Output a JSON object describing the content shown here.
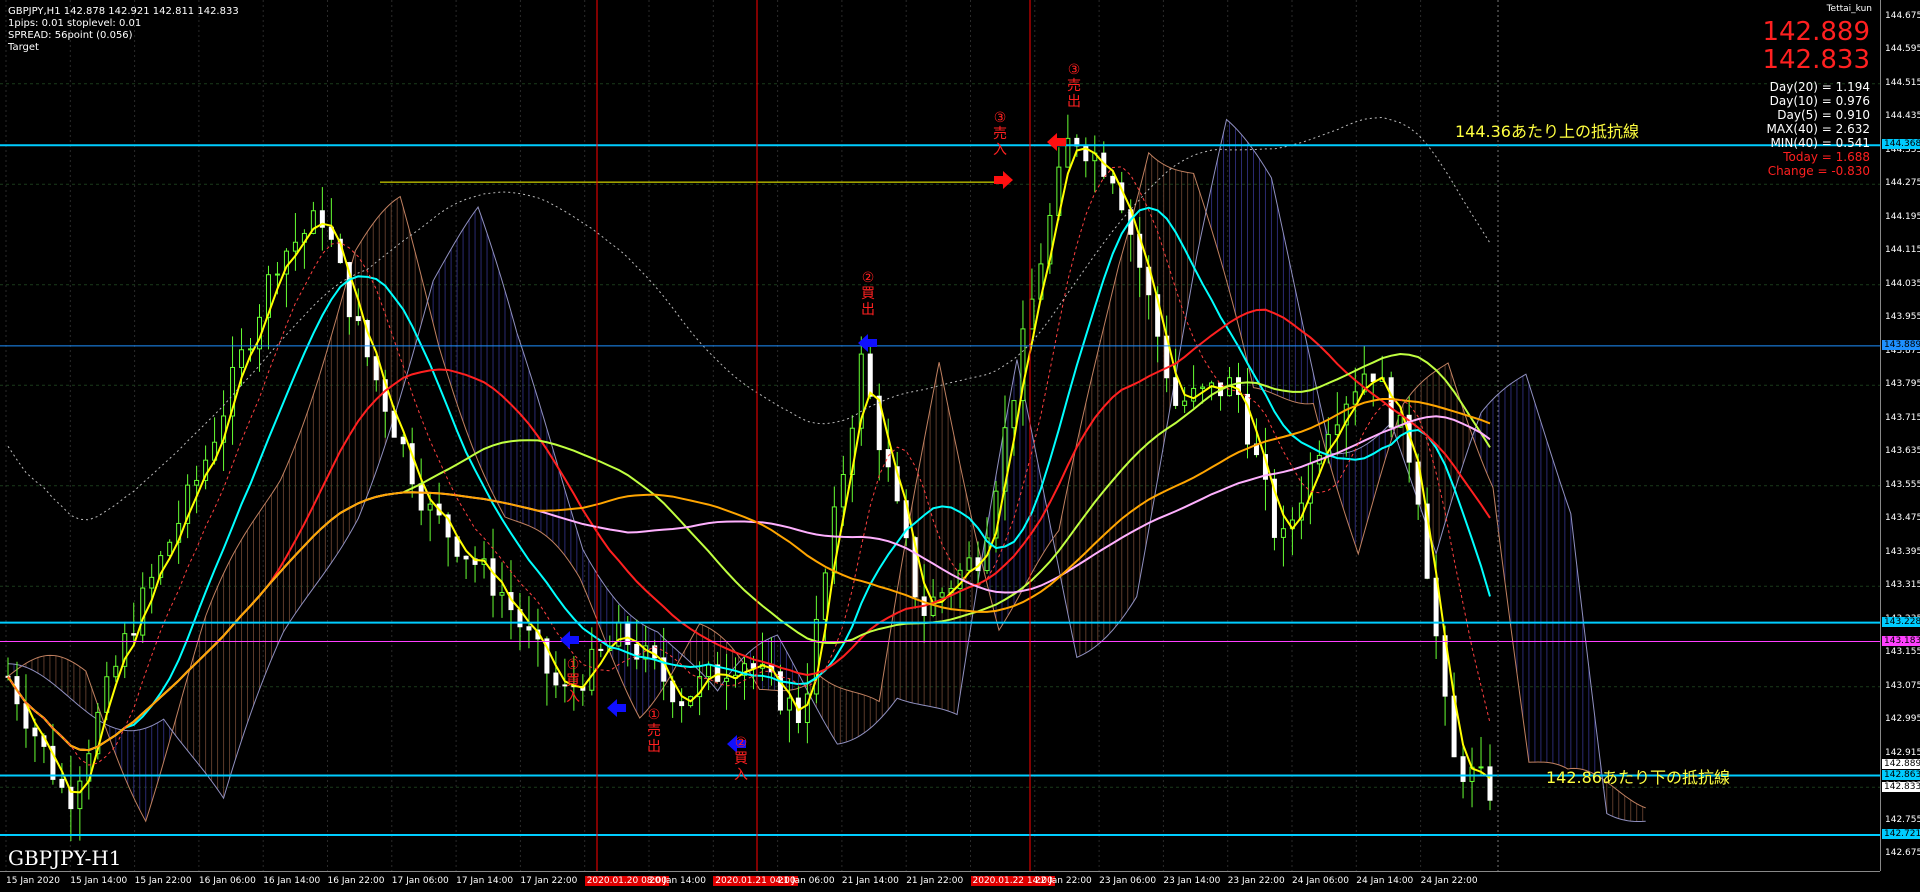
{
  "header": {
    "symbol_line": "GBPJPY,H1  142.878 142.921 142.811 142.833",
    "pips_line": "1pips: 0.01  stoplevel: 0.01",
    "spread_line": "SPREAD: 56point (0.056)",
    "target_line": "Target"
  },
  "panel": {
    "author": "Tettai_kun",
    "bid": "142.889",
    "ask": "142.833",
    "day20": "Day(20) = 1.194",
    "day10": "Day(10) = 0.976",
    "day5": "Day(5) = 0.910",
    "max40": "MAX(40) = 2.632",
    "min40": "MIN(40) = 0.541",
    "today": "Today = 1.688",
    "change": "Change = -0.830"
  },
  "symbol_watermark": "GBPJPY-H1",
  "annotations": {
    "upper": "144.36あたり上の抵抗線",
    "lower": "142.86あたり下の抵抗線"
  },
  "markers": {
    "m1_buy": "①\n買\n入",
    "m1_sell": "①\n売\n出",
    "m2_buy": "②\n買\n入",
    "m2_sell": "②\n買\n出",
    "m3_buy": "③\n売\n入",
    "m3_sell": "③\n売\n出"
  },
  "y_axis": {
    "ticks": [
      "144.675",
      "144.595",
      "144.515",
      "144.435",
      "144.355",
      "144.275",
      "144.195",
      "144.115",
      "144.035",
      "143.955",
      "143.875",
      "143.795",
      "143.715",
      "143.635",
      "143.555",
      "143.475",
      "143.395",
      "143.315",
      "143.235",
      "143.155",
      "143.075",
      "142.995",
      "142.915",
      "142.835",
      "142.755",
      "142.675"
    ],
    "tags": [
      {
        "text": "144.368",
        "color": "#00ccff"
      },
      {
        "text": "143.889",
        "color": "#1e90ff"
      },
      {
        "text": "143.228",
        "color": "#00ccff"
      },
      {
        "text": "143.183",
        "color": "#ff40ff"
      },
      {
        "text": "142.889",
        "color": "#ffffff"
      },
      {
        "text": "142.863",
        "color": "#00ccff"
      },
      {
        "text": "142.833",
        "color": "#ffffff"
      },
      {
        "text": "142.721",
        "color": "#00ccff"
      }
    ]
  },
  "x_axis": {
    "ticks": [
      {
        "text": "15 Jan 2020",
        "hl": false
      },
      {
        "text": "15 Jan 14:00",
        "hl": false
      },
      {
        "text": "15 Jan 22:00",
        "hl": false
      },
      {
        "text": "16 Jan 06:00",
        "hl": false
      },
      {
        "text": "16 Jan 14:00",
        "hl": false
      },
      {
        "text": "16 Jan 22:00",
        "hl": false
      },
      {
        "text": "17 Jan 06:00",
        "hl": false
      },
      {
        "text": "17 Jan 14:00",
        "hl": false
      },
      {
        "text": "17 Jan 22:00",
        "hl": false
      },
      {
        "text": "2020.01.20 08:00",
        "hl": true
      },
      {
        "text": "20 Jan 14:00",
        "hl": false
      },
      {
        "text": "2020.01.21 04:00",
        "hl": true
      },
      {
        "text": "21 Jan 06:00",
        "hl": false
      },
      {
        "text": "21 Jan 14:00",
        "hl": false
      },
      {
        "text": "21 Jan 22:00",
        "hl": false
      },
      {
        "text": "2020.01.22 14:00",
        "hl": true
      },
      {
        "text": "22 Jan 22:00",
        "hl": false
      },
      {
        "text": "23 Jan 06:00",
        "hl": false
      },
      {
        "text": "23 Jan 14:00",
        "hl": false
      },
      {
        "text": "23 Jan 22:00",
        "hl": false
      },
      {
        "text": "24 Jan 06:00",
        "hl": false
      },
      {
        "text": "24 Jan 14:00",
        "hl": false
      },
      {
        "text": "24 Jan 22:00",
        "hl": false
      }
    ]
  },
  "colors": {
    "bull_candle": "#66ff33",
    "bear_candle": "#ffffff",
    "resistance": "#00ccff",
    "vline": "#ff0000",
    "fast_ma": "#ffff00",
    "mid_ma": "#00ffff",
    "slow_ma": "#ff2020",
    "ma200": "#ffa500",
    "ma_pink": "#ffb0ff",
    "ma_white": "#ffffcc",
    "buy_arrow": "#1010ff",
    "sell_arrow": "#ff1010"
  }
}
